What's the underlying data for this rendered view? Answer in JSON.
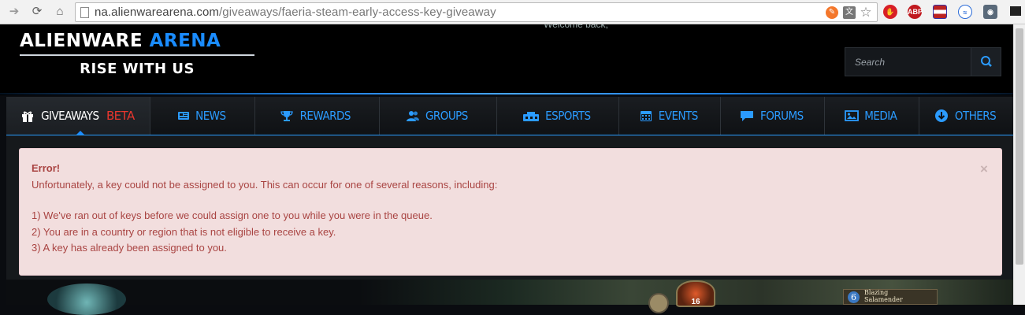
{
  "browser": {
    "url_host": "na.alienwarearena.com",
    "url_path": "/giveaways/faeria-steam-early-access-key-giveaway",
    "extensions": [
      "abp-icon",
      "flag-icon",
      "sync-icon",
      "eye-icon"
    ],
    "abp_label": "ABP"
  },
  "header": {
    "welcome_text": "Welcome back,",
    "logo_brand": "ALIENWARE",
    "logo_arena": "ARENA",
    "logo_tagline": "RISE WITH US",
    "search_placeholder": "Search"
  },
  "nav": {
    "items": [
      {
        "label": "GIVEAWAYS",
        "badge": "BETA",
        "icon": "gift-icon",
        "active": true
      },
      {
        "label": "NEWS",
        "icon": "news-icon"
      },
      {
        "label": "REWARDS",
        "icon": "trophy-icon"
      },
      {
        "label": "GROUPS",
        "icon": "users-icon"
      },
      {
        "label": "ESPORTS",
        "icon": "esports-icon"
      },
      {
        "label": "EVENTS",
        "icon": "calendar-icon"
      },
      {
        "label": "FORUMS",
        "icon": "chat-icon"
      },
      {
        "label": "MEDIA",
        "icon": "image-icon"
      },
      {
        "label": "OTHERS",
        "icon": "arrow-circle-icon"
      }
    ]
  },
  "alert": {
    "title": "Error!",
    "intro": "Unfortunately, a key could not be assigned to you. This can occur for one of several reasons, including:",
    "reasons": [
      "1) We've ran out of keys before we could assign one to you while you were in the queue.",
      "2) You are in a country or region that is not eligible to receive a key.",
      "3) A key has already been assigned to you."
    ],
    "close_glyph": "×"
  },
  "art": {
    "card_cost": "6",
    "card_name_1": "Blazing",
    "card_name_2": "Salamender",
    "coin_value": "16"
  },
  "colors": {
    "accent_blue": "#2b9bff",
    "beta_red": "#e8362e",
    "alert_bg": "#f2dede",
    "alert_text": "#a94442"
  }
}
